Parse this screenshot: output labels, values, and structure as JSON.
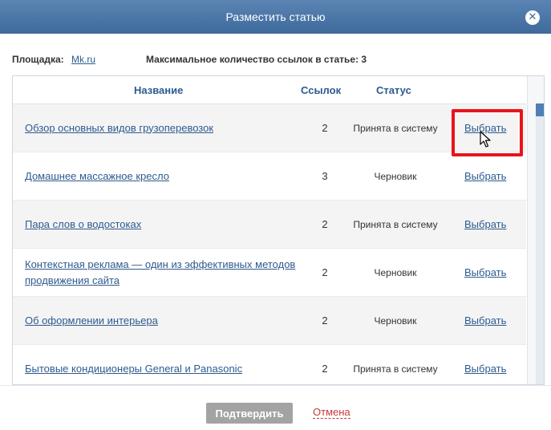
{
  "dialog": {
    "title": "Разместить статью",
    "close_icon": "✕"
  },
  "info": {
    "site_label": "Площадка:",
    "site_value": "Mk.ru",
    "max_links": "Максимальное количество ссылок в статье: 3"
  },
  "table": {
    "headers": {
      "name": "Название",
      "links": "Ссылок",
      "status": "Статус"
    },
    "rows": [
      {
        "name": "Обзор основных видов грузоперевозок",
        "links": "2",
        "status": "Принята в систему",
        "action": "Выбрать"
      },
      {
        "name": "Домашнее массажное кресло",
        "links": "3",
        "status": "Черновик",
        "action": "Выбрать"
      },
      {
        "name": "Пара слов о водостоках",
        "links": "2",
        "status": "Принята в систему",
        "action": "Выбрать"
      },
      {
        "name": "Контекстная реклама — один из эффективных методов продвижения сайта",
        "links": "2",
        "status": "Черновик",
        "action": "Выбрать"
      },
      {
        "name": "Об оформлении интерьера",
        "links": "2",
        "status": "Черновик",
        "action": "Выбрать"
      },
      {
        "name": "Бытовые кондиционеры General и Panasonic",
        "links": "2",
        "status": "Принята в систему",
        "action": "Выбрать"
      }
    ]
  },
  "footer": {
    "confirm_label": "Подтвердить",
    "cancel_label": "Отмена"
  },
  "colors": {
    "titlebar": "#4a76a8",
    "link": "#2d5b8f",
    "highlight": "#e8141a",
    "cancel": "#c83a3a"
  }
}
